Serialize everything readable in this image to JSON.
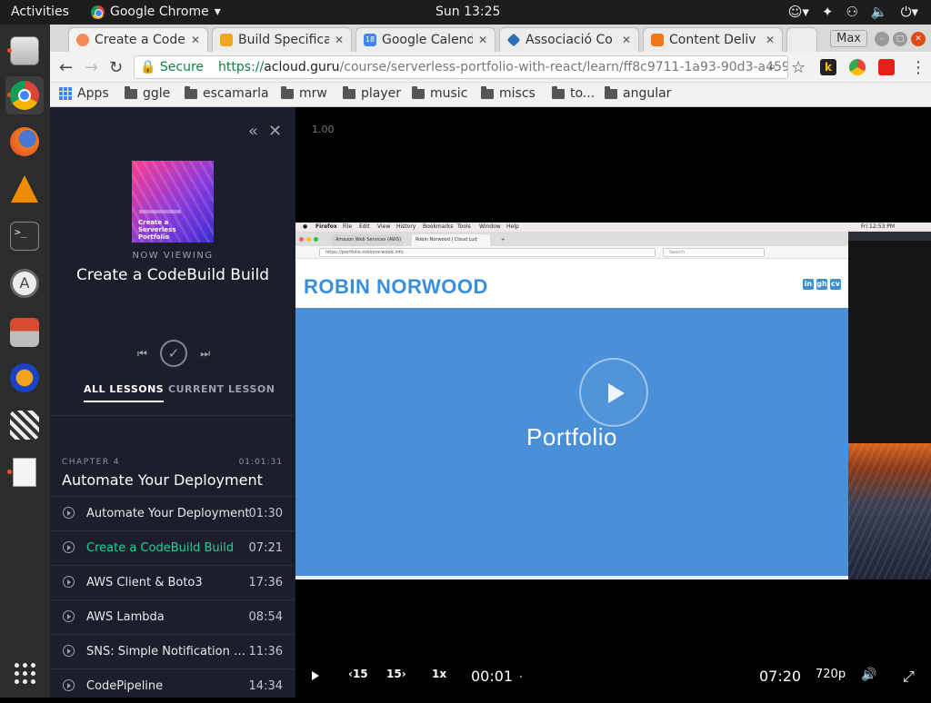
{
  "system": {
    "activities": "Activities",
    "app_name": "Google Chrome",
    "clock": "Sun 13:25"
  },
  "browser": {
    "tabs": [
      {
        "label": "Create a Code",
        "active": true,
        "favicon_color": "#f08c56"
      },
      {
        "label": "Build Specifica",
        "active": false,
        "favicon_color": "#f0a81a"
      },
      {
        "label": "Google Calend",
        "active": false,
        "favicon_color": "#4285f4",
        "favicon_text": "18"
      },
      {
        "label": "Associació Co",
        "active": false,
        "favicon_color": "#2d6fb4"
      },
      {
        "label": "Content Deliv",
        "active": false,
        "favicon_color": "#f0771a"
      }
    ],
    "window_label": "Max",
    "secure_label": "Secure",
    "url_scheme": "https://",
    "url_host": "acloud.guru",
    "url_path": "/course/serverless-portfolio-with-react/learn/ff8c9711-1a93-90d3-a459-4...",
    "bookmarks": [
      "Apps",
      "ggle",
      "escamarla",
      "mrw",
      "player",
      "music",
      "miscs",
      "to...",
      "angular"
    ]
  },
  "course": {
    "thumbnail_title": "Create a Serverless Portfolio",
    "now_viewing_label": "NOW VIEWING",
    "current_title": "Create a CodeBuild Build",
    "tabs": {
      "all": "ALL LESSONS",
      "current": "CURRENT LESSON"
    },
    "chapter_label": "CHAPTER 4",
    "chapter_duration": "01:01:31",
    "chapter_title": "Automate Your Deployment",
    "lessons": [
      {
        "name": "Automate Your Deployment",
        "time": "01:30",
        "current": false
      },
      {
        "name": "Create a CodeBuild Build",
        "time": "07:21",
        "current": true
      },
      {
        "name": "AWS Client & Boto3",
        "time": "17:36",
        "current": false
      },
      {
        "name": "AWS Lambda",
        "time": "08:54",
        "current": false
      },
      {
        "name": "SNS: Simple Notification Serv...",
        "time": "11:36",
        "current": false
      },
      {
        "name": "CodePipeline",
        "time": "14:34",
        "current": false
      }
    ]
  },
  "video": {
    "speed_note": "1.00",
    "inner": {
      "mac_menu": [
        "Firefox",
        "File",
        "Edit",
        "View",
        "History",
        "Bookmarks",
        "Tools",
        "Window",
        "Help"
      ],
      "mac_clock": "Fri 12:53 PM",
      "ff_tab1": "Amazon Web Services (AWS)",
      "ff_tab2": "Robin Norwood | Cloud Lud",
      "ff_url": "https://portfolio.robinnorwood.info",
      "ff_search": "Search",
      "site_name": "ROBIN NORWOOD",
      "hero_title": "Portfolio",
      "social": [
        "in",
        "gh",
        "cv"
      ]
    },
    "controls": {
      "rewind": "‹15",
      "forward": "15›",
      "speed": "1x",
      "elapsed": "00:01",
      "duration": "07:20",
      "quality": "720p"
    }
  },
  "colors": {
    "accent_green": "#1ad596",
    "hero_blue": "#4a90d9",
    "site_name_blue": "#3b8fd6"
  }
}
